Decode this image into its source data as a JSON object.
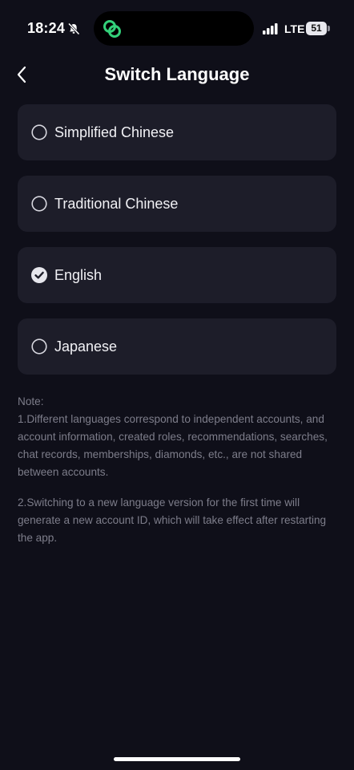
{
  "status_bar": {
    "time": "18:24",
    "network": "LTE",
    "battery": "51",
    "icons": [
      "bell-slash-icon",
      "app-link-icon",
      "signal-icon"
    ]
  },
  "header": {
    "back_icon": "chevron-left-icon",
    "title": "Switch Language"
  },
  "languages": [
    {
      "label": "Simplified Chinese",
      "selected": false
    },
    {
      "label": "Traditional Chinese",
      "selected": false
    },
    {
      "label": "English",
      "selected": true
    },
    {
      "label": "Japanese",
      "selected": false
    }
  ],
  "note": {
    "heading": "Note:",
    "item1": "1.Different languages correspond to independent accounts, and account information, created roles, recommendations, searches, chat records, memberships, diamonds, etc., are not shared between accounts.",
    "item2": "2.Switching to a new language version for the first time will generate a new account ID, which will take effect after restarting the app."
  },
  "colors": {
    "background": "#0f0f19",
    "card": "#1d1d29",
    "accent_green": "#33d17a",
    "note_text": "#7d7d8a"
  }
}
